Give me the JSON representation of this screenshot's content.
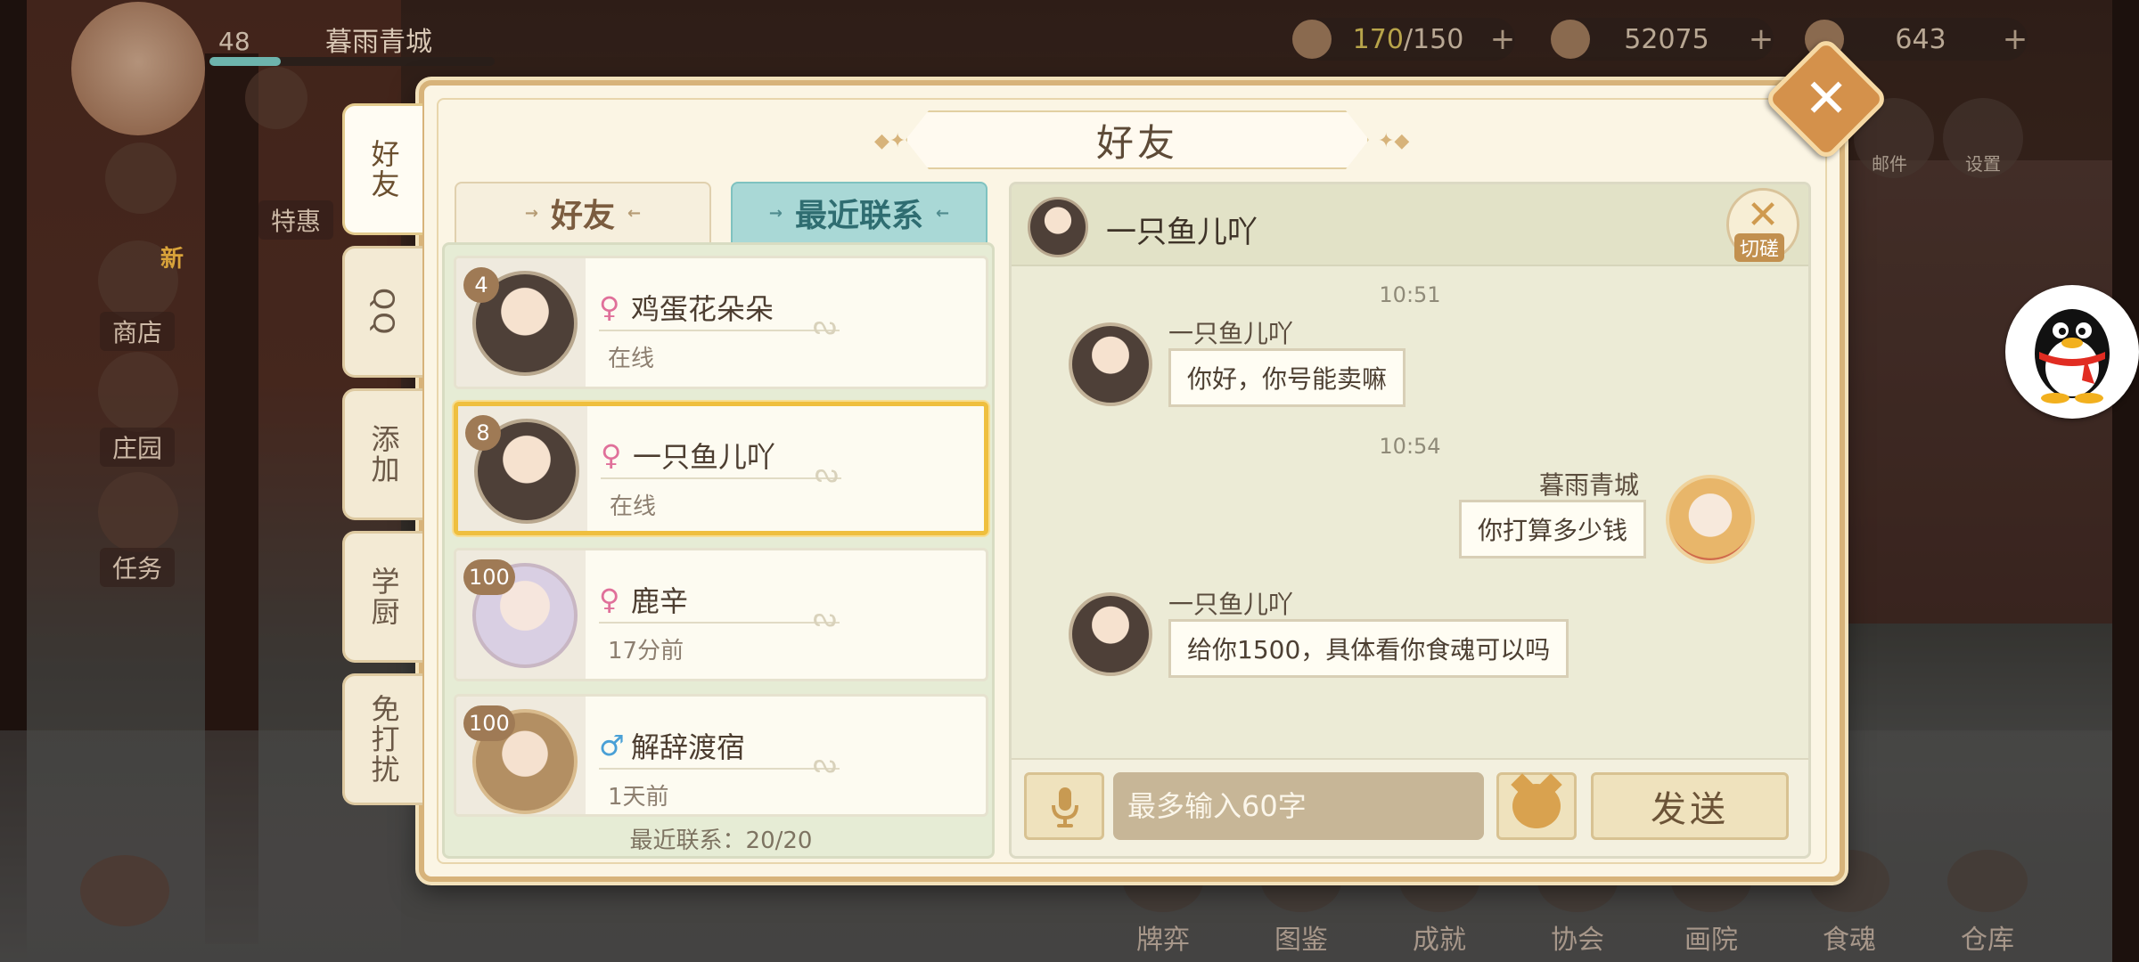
{
  "game": {
    "player": {
      "level": "48",
      "name": "暮雨青城"
    },
    "resources": {
      "stamina": "170",
      "stamina_max": "/150",
      "coins": "52075",
      "diamonds": "643"
    },
    "left_menu": {
      "shop": "商店",
      "shop_new": "新",
      "manor": "庄园",
      "task": "任务",
      "special": "特惠"
    },
    "right_menu": {
      "mail": "邮件",
      "settings": "设置"
    },
    "bottom_nav": [
      "牌弈",
      "图鉴",
      "成就",
      "协会",
      "画院",
      "食魂",
      "仓库"
    ]
  },
  "dialog": {
    "title": "好友",
    "close_label": "✕",
    "side_tabs": [
      "好友",
      "QQ",
      "添加",
      "学厨",
      "免打扰"
    ],
    "sub_tabs": {
      "friends": "好友",
      "recent": "最近联系"
    },
    "contacts": [
      {
        "level": "4",
        "gender": "♀",
        "name": "鸡蛋花朵朵",
        "status": "在线"
      },
      {
        "level": "8",
        "gender": "♀",
        "name": "一只鱼儿吖",
        "status": "在线"
      },
      {
        "level": "100",
        "gender": "♀",
        "name": "鹿辛",
        "status": "17分前"
      },
      {
        "level": "100",
        "gender": "♂",
        "name": "解辞渡宿",
        "status": "1天前"
      }
    ],
    "recent_count": "最近联系：20/20",
    "chat": {
      "partner": "一只鱼儿吖",
      "pk_label": "切磋",
      "messages": [
        {
          "time": "10:51",
          "sender": "一只鱼儿吖",
          "text": "你好，你号能卖嘛"
        },
        {
          "time": "10:54",
          "sender": "暮雨青城",
          "text": "你打算多少钱"
        },
        {
          "sender": "一只鱼儿吖",
          "text": "给你1500，具体看你食魂可以吗"
        }
      ],
      "input_placeholder": "最多输入60字",
      "send_label": "发送"
    }
  },
  "colors": {
    "dialog_border": "#d7b37a",
    "recent_tab": "#a9d8d6",
    "selected_border": "#efbf3e",
    "close_button": "#d4914b"
  }
}
